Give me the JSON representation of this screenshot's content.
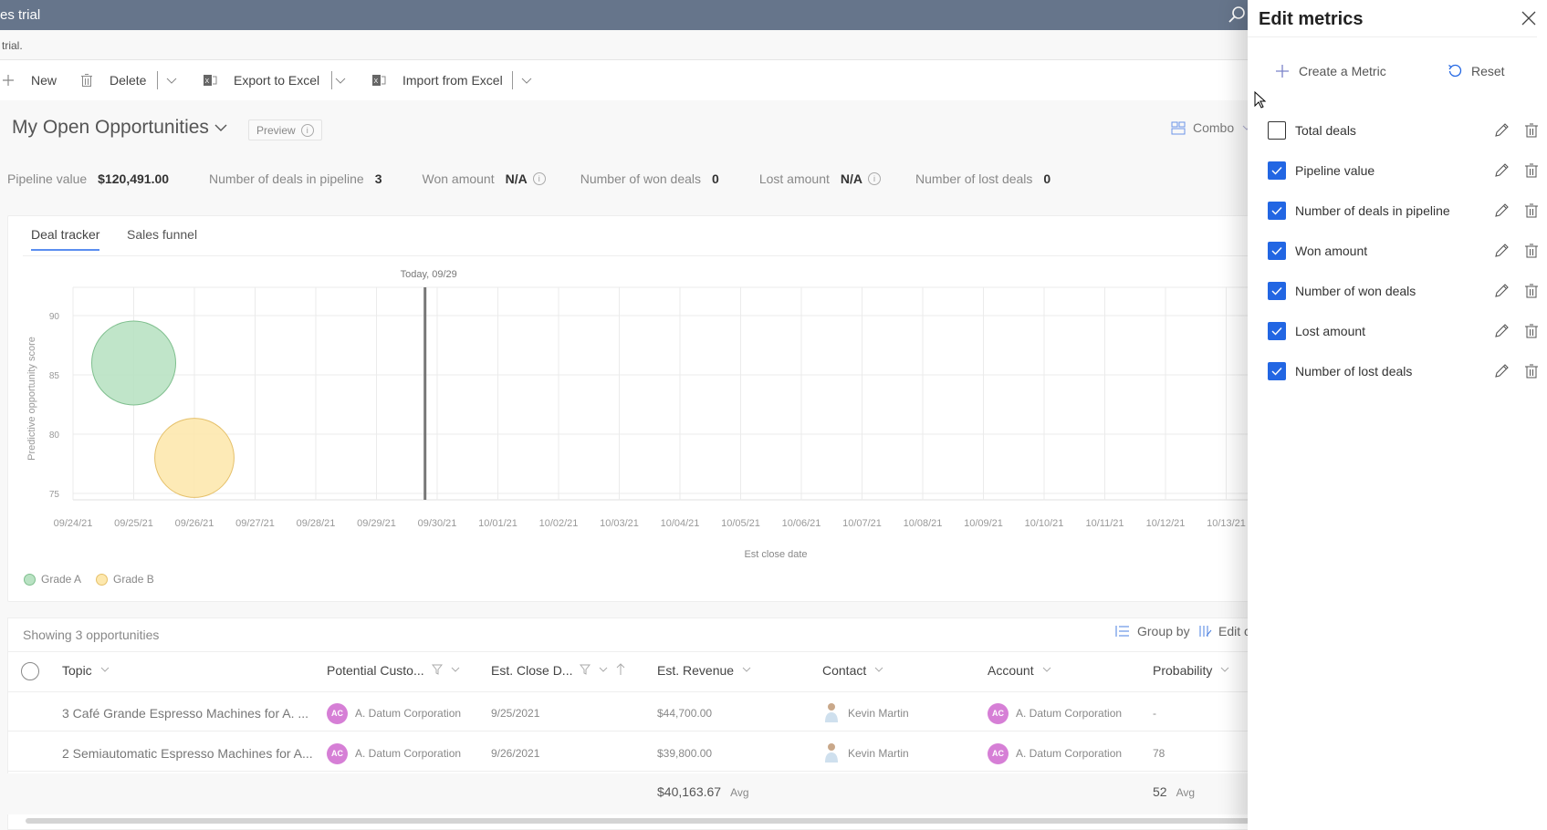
{
  "titlebar": {
    "title": "es trial",
    "search_icon": "search-icon"
  },
  "banner": {
    "text": "trial."
  },
  "commandbar": {
    "new_label": "New",
    "delete_label": "Delete",
    "export_label": "Export to Excel",
    "import_label": "Import from Excel"
  },
  "view": {
    "title": "My Open Opportunities",
    "preview_label": "Preview",
    "combo_label": "Combo"
  },
  "metrics": [
    {
      "label": "Pipeline value",
      "value": "$120,491.00",
      "info": false
    },
    {
      "label": "Number of deals in pipeline",
      "value": "3",
      "info": false
    },
    {
      "label": "Won amount",
      "value": "N/A",
      "info": true
    },
    {
      "label": "Number of won deals",
      "value": "0",
      "info": false
    },
    {
      "label": "Lost amount",
      "value": "N/A",
      "info": true
    },
    {
      "label": "Number of lost deals",
      "value": "0",
      "info": false
    }
  ],
  "tabs": [
    {
      "label": "Deal tracker",
      "active": true
    },
    {
      "label": "Sales funnel",
      "active": false
    }
  ],
  "chart_data": {
    "type": "scatter",
    "subtype": "bubble",
    "title": "",
    "xlabel": "Est close date",
    "ylabel": "Predictive opportunity score",
    "x_ticks": [
      "09/24/21",
      "09/25/21",
      "09/26/21",
      "09/27/21",
      "09/28/21",
      "09/29/21",
      "09/30/21",
      "10/01/21",
      "10/02/21",
      "10/03/21",
      "10/04/21",
      "10/05/21",
      "10/06/21",
      "10/07/21",
      "10/08/21",
      "10/09/21",
      "10/10/21",
      "10/11/21",
      "10/12/21",
      "10/13/21"
    ],
    "y_ticks": [
      75,
      80,
      85,
      90
    ],
    "ylim": [
      74.5,
      92.5
    ],
    "grid": true,
    "today_marker": {
      "label": "Today, 09/29",
      "x_day_offset": 5.8
    },
    "series": [
      {
        "name": "Grade A",
        "color": "#b9e2c3",
        "stroke": "#7fbf8e",
        "points": [
          {
            "x": "09/25/21",
            "x_index": 1,
            "y": 86,
            "revenue": 44700
          }
        ]
      },
      {
        "name": "Grade B",
        "color": "#fde8ae",
        "stroke": "#e5c06a",
        "points": [
          {
            "x": "09/26/21",
            "x_index": 2,
            "y": 78,
            "revenue": 39800
          }
        ]
      }
    ],
    "legend": "bottom-left"
  },
  "table": {
    "showing": "Showing 3 opportunities",
    "group_by_label": "Group by",
    "edit_columns_label": "Edit c",
    "columns": [
      {
        "label": "Topic",
        "filter": false,
        "sort": false
      },
      {
        "label": "Potential Custo...",
        "filter": true,
        "sort": false
      },
      {
        "label": "Est. Close D...",
        "filter": true,
        "sort": true
      },
      {
        "label": "Est. Revenue",
        "filter": false,
        "sort": false
      },
      {
        "label": "Contact",
        "filter": false,
        "sort": false
      },
      {
        "label": "Account",
        "filter": false,
        "sort": false
      },
      {
        "label": "Probability",
        "filter": false,
        "sort": false
      }
    ],
    "rows": [
      {
        "topic": "3 Café Grande Espresso Machines for A. ...",
        "customer_initials": "AC",
        "customer": "A. Datum Corporation",
        "close_date": "9/25/2021",
        "revenue": "$44,700.00",
        "contact": "Kevin Martin",
        "account_initials": "AC",
        "account": "A. Datum Corporation",
        "probability": "-"
      },
      {
        "topic": "2 Semiautomatic Espresso Machines for A...",
        "customer_initials": "AC",
        "customer": "A. Datum Corporation",
        "close_date": "9/26/2021",
        "revenue": "$39,800.00",
        "contact": "Kevin Martin",
        "account_initials": "AC",
        "account": "A. Datum Corporation",
        "probability": "78"
      }
    ],
    "footer": {
      "revenue_avg": "$40,163.67",
      "probability_avg": "52",
      "avg_label": "Avg"
    }
  },
  "panel": {
    "title": "Edit metrics",
    "create_label": "Create a Metric",
    "reset_label": "Reset",
    "items": [
      {
        "label": "Total deals",
        "checked": false
      },
      {
        "label": "Pipeline value",
        "checked": true
      },
      {
        "label": "Number of deals in pipeline",
        "checked": true
      },
      {
        "label": "Won amount",
        "checked": true
      },
      {
        "label": "Number of won deals",
        "checked": true
      },
      {
        "label": "Lost amount",
        "checked": true
      },
      {
        "label": "Number of lost deals",
        "checked": true
      }
    ]
  },
  "colors": {
    "accent": "#2266e3",
    "tab_underline": "#5b8ef0",
    "avatar": "#d67fd6",
    "titlebar": "#66758b"
  }
}
